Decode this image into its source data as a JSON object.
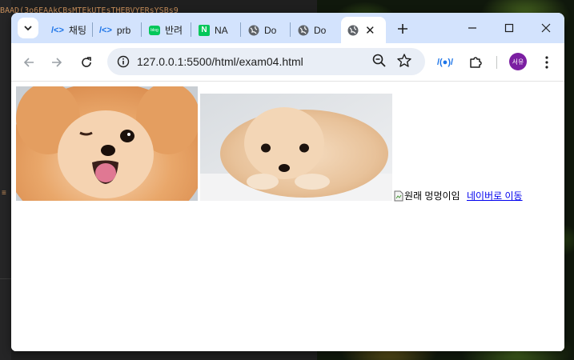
{
  "browser": {
    "tabs": [
      {
        "title": "채팅",
        "icon": "code-icon"
      },
      {
        "title": "prb",
        "icon": "code-icon"
      },
      {
        "title": "반려",
        "icon": "blog-icon"
      },
      {
        "title": "NA",
        "icon": "naver-icon"
      },
      {
        "title": "Do",
        "icon": "globe-icon"
      },
      {
        "title": "Do",
        "icon": "globe-icon"
      },
      {
        "title": "",
        "icon": "globe-icon",
        "active": true
      }
    ],
    "url": "127.0.0.1:5500/html/exam04.html",
    "profile_initials": "서유",
    "profile_color": "#7b1fa2"
  },
  "page": {
    "images": [
      {
        "alt": "winking pomeranian dog",
        "depicts": "orange pomeranian winking with tongue out"
      },
      {
        "alt": "cream pomeranian puppy lying down",
        "depicts": "cream colored puppy resting on paws"
      }
    ],
    "broken_image_alt": "원래 멍멍이임",
    "link_text": "네이버로 이동",
    "link_color": "#0000ee"
  },
  "background": {
    "editor_snippet": "BAAD(3o6EAAkCBsMTEkUTEsTHEBVYERsYSBs9"
  }
}
